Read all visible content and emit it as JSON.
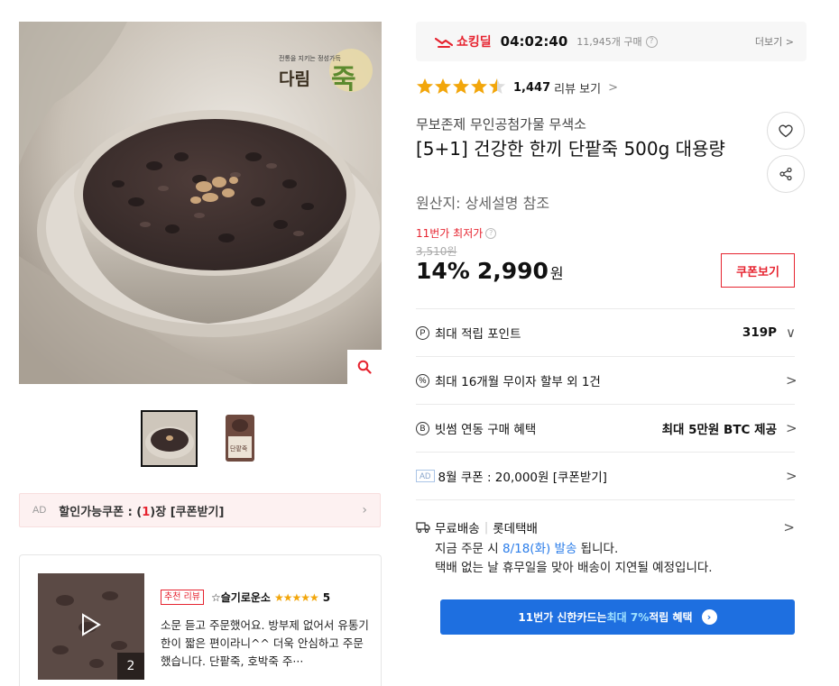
{
  "product_images": {
    "brand_logo_text": "다림죽",
    "thumbnail_label": "단팥죽",
    "zoom_icon": "magnifier-icon"
  },
  "coupon_bar": {
    "ad": "AD",
    "label_prefix": "할인가능쿠폰 : (",
    "count": "1",
    "label_suffix": ")장 [쿠폰받기]"
  },
  "review": {
    "tag": "추천 리뷰",
    "reviewer": "☆슬기로운소",
    "stars": "★★★★★",
    "score": "5",
    "text": "소문 듣고 주문했어요. 방부제 없어서 유통기한이 짧은 편이라니^^ 더욱 안심하고 주문했습니다. 단팥죽, 호박죽 주···",
    "media_count": "2"
  },
  "deal": {
    "label": "쇼킹딜",
    "timer": "04:02:40",
    "buy_count": "11,945개 구매",
    "more": "더보기 >"
  },
  "rating": {
    "stars": "★★★★★",
    "value": 4.5,
    "count": "1,447",
    "link": "리뷰 보기",
    "chev": ">"
  },
  "product": {
    "brand": "무보존제 무인공첨가물 무색소",
    "title": "[5+1] 건강한 한끼 단팥죽 500g 대용량",
    "origin": "원산지: 상세설명 참조"
  },
  "price": {
    "lowest_label": "11번가 최저가",
    "original": "3,510원",
    "discount": "14%",
    "final": "2,990",
    "unit": "원",
    "coupon_button": "쿠폰보기"
  },
  "info_rows": [
    {
      "icon_glyph": "P",
      "icon": "point-icon",
      "label": "최대 적립 포인트",
      "value": "319P",
      "chev": "∨"
    },
    {
      "icon_glyph": "%",
      "icon": "installment-icon",
      "label": "최대 16개월 무이자 할부 외 1건",
      "value": "",
      "chev": ">"
    },
    {
      "icon_glyph": "B",
      "icon": "bitsum-icon",
      "label": "빗썸 연동 구매 혜택",
      "value": "최대 5만원 BTC 제공",
      "chev": ">"
    },
    {
      "icon_glyph": "AD",
      "icon": "ad-badge",
      "label": "8월 쿠폰 : 20,000원 [쿠폰받기]",
      "value": "",
      "chev": ">"
    }
  ],
  "delivery": {
    "free": "무료배송",
    "courier": "롯데택배",
    "line2_prefix": "지금 주문 시 ",
    "ship_date": "8/18(화) 발송",
    "line2_suffix": " 됩니다.",
    "line3": "택배 없는 날 휴무일을 맞아 배송이 지연될 예정입니다.",
    "chev": ">"
  },
  "card_banner": {
    "prefix": "11번가 신한카드는 ",
    "highlight": "최대 7%",
    "suffix": " 적립 혜택"
  },
  "colors": {
    "accent_red": "#e6232f",
    "star": "#f2a60b",
    "banner_blue": "#1e6fe0",
    "link_blue": "#2b7de9"
  }
}
